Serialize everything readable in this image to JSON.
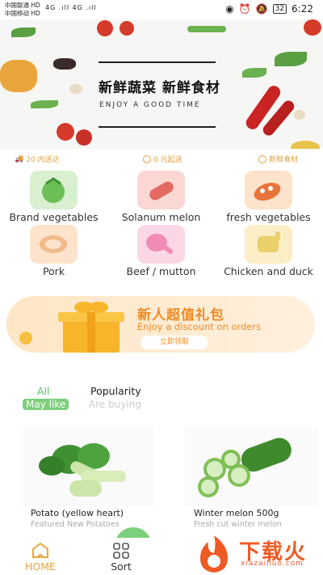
{
  "status_bar": {
    "carrier1": "中国联通 HD",
    "carrier2": "中国移动 HD",
    "signal_text": "4G .ıll 4G .ıll",
    "battery": "32",
    "time": "6:22"
  },
  "banner": {
    "title": "新鲜蔬菜 新鲜食材",
    "subtitle": "ENJOY A GOOD TIME"
  },
  "benefits": [
    {
      "label": "20 内送达"
    },
    {
      "label": "0 元起送"
    },
    {
      "label": "新鲜食材"
    }
  ],
  "categories": [
    {
      "label": "Brand vegetables",
      "color": "#d8f0d0",
      "icon": "tomato-icon"
    },
    {
      "label": "Solanum melon",
      "color": "#fbd7d3",
      "icon": "sausage-icon"
    },
    {
      "label": "fresh vegetables",
      "color": "#fde3cc",
      "icon": "eggplant-icon"
    },
    {
      "label": "Pork",
      "color": "#fde3cc",
      "icon": "steak-icon"
    },
    {
      "label": "Beef / mutton",
      "color": "#fbd7e6",
      "icon": "drumstick-icon"
    },
    {
      "label": "Chicken and duck",
      "color": "#fbeec7",
      "icon": "poultry-icon"
    }
  ],
  "promo": {
    "title": "新人超值礼包",
    "subtitle": "Enjoy a discount on orders",
    "button": "立即领取"
  },
  "tabs": [
    {
      "main": "All",
      "sub": "May like",
      "active": true
    },
    {
      "main": "Popularity",
      "sub": "Are buying",
      "active": false
    }
  ],
  "products": [
    {
      "name": "Potato (yellow heart)",
      "desc": "Featured New Potatoes",
      "icon": "bok-choy-icon"
    },
    {
      "name": "Winter melon  500g",
      "desc": "Fresh cut winter melon",
      "icon": "cucumber-icon"
    }
  ],
  "bottom_nav": [
    {
      "label": "HOME",
      "icon": "home-icon",
      "active": true
    },
    {
      "label": "Sort",
      "icon": "grid-icon",
      "active": false
    }
  ],
  "watermark": {
    "text": "下载火",
    "sub": "xiazaihuo.com"
  },
  "colors": {
    "accent_green": "#5cbf6a",
    "orange": "#f08a24",
    "active_tab_bg": "#7ccf7c"
  }
}
